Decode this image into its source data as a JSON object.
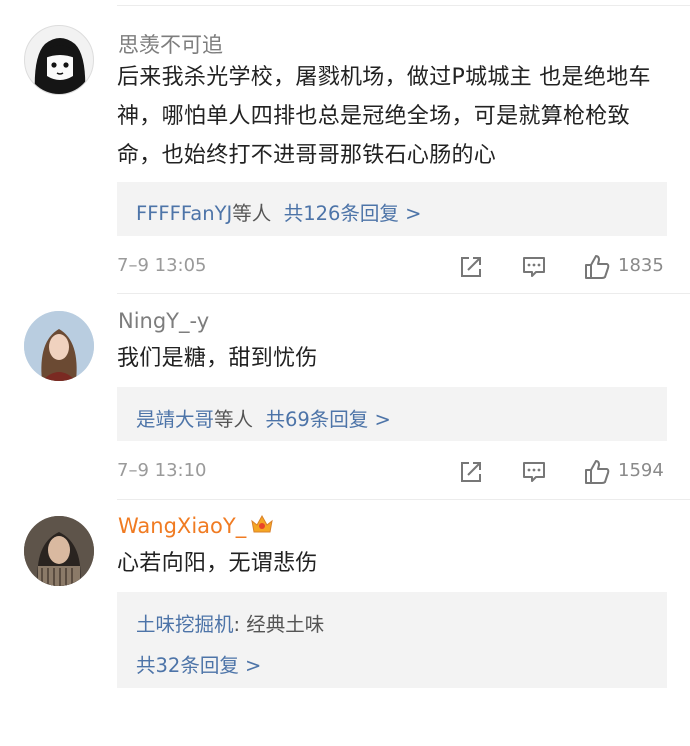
{
  "comments": [
    {
      "username": "思羡不可追",
      "text": "后来我杀光学校，屠戮机场，做过P城城主 也是绝地车神，哪怕单人四排也总是冠绝全场，可是就算枪枪致命，也始终打不进哥哥那铁石心肠的心",
      "replies_user": "FFFFFanYJ",
      "replies_mid": "等人",
      "replies_count": "共126条回复 >",
      "time": "7–9 13:05",
      "likes": "1835"
    },
    {
      "username": "NingY_-y",
      "text": "我们是糖，甜到忧伤",
      "replies_user": "是靖大哥",
      "replies_mid": "等人",
      "replies_count": "共69条回复 >",
      "time": "7–9 13:10",
      "likes": "1594"
    },
    {
      "username": "WangXiaoY_",
      "text": "心若向阳，无谓悲伤",
      "reply_author": "土味挖掘机",
      "reply_text": ": 经典土味",
      "replies_count": "共32条回复 >"
    }
  ],
  "icons": [
    "share-icon",
    "comment-icon",
    "like-icon",
    "crown-icon"
  ],
  "colors": {
    "link": "#4d74a8",
    "vip": "#f07b22",
    "muted": "#9a9a9a",
    "reply_bg": "#f3f3f3"
  }
}
